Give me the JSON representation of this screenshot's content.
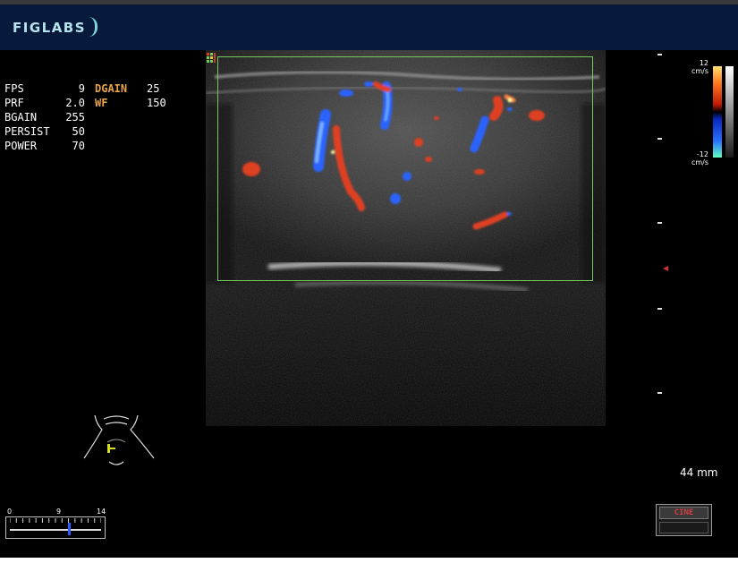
{
  "header": {
    "brand": "FIGLABS"
  },
  "params_left": [
    {
      "label": "FPS",
      "value": "9"
    },
    {
      "label": "PRF",
      "value": "2.0"
    },
    {
      "label": "BGAIN",
      "value": "255"
    },
    {
      "label": "PERSIST",
      "value": "50"
    },
    {
      "label": "POWER",
      "value": "70"
    }
  ],
  "params_right": [
    {
      "label": "DGAIN",
      "value": "25"
    },
    {
      "label": "WF",
      "value": "150"
    }
  ],
  "color_scale": {
    "top_value": "12",
    "top_unit": "cm/s",
    "bottom_value": "-12",
    "bottom_unit": "cm/s"
  },
  "depth": {
    "value": "44 mm"
  },
  "cine": {
    "label": "CINE",
    "slider_min": "0",
    "slider_mid": "9",
    "slider_max": "14",
    "current_frame": 9,
    "total_frames": 14
  },
  "colors": {
    "header_bg": "#071a3c",
    "roi_border": "#78c860",
    "param_accent": "#e8a24a",
    "doppler_red": "#e04020",
    "doppler_blue": "#2060ff"
  },
  "icons": {
    "body_marker": "neck-body-marker-icon",
    "focus": "focus-marker-icon",
    "roi_corner": "roi-marker-icon"
  }
}
